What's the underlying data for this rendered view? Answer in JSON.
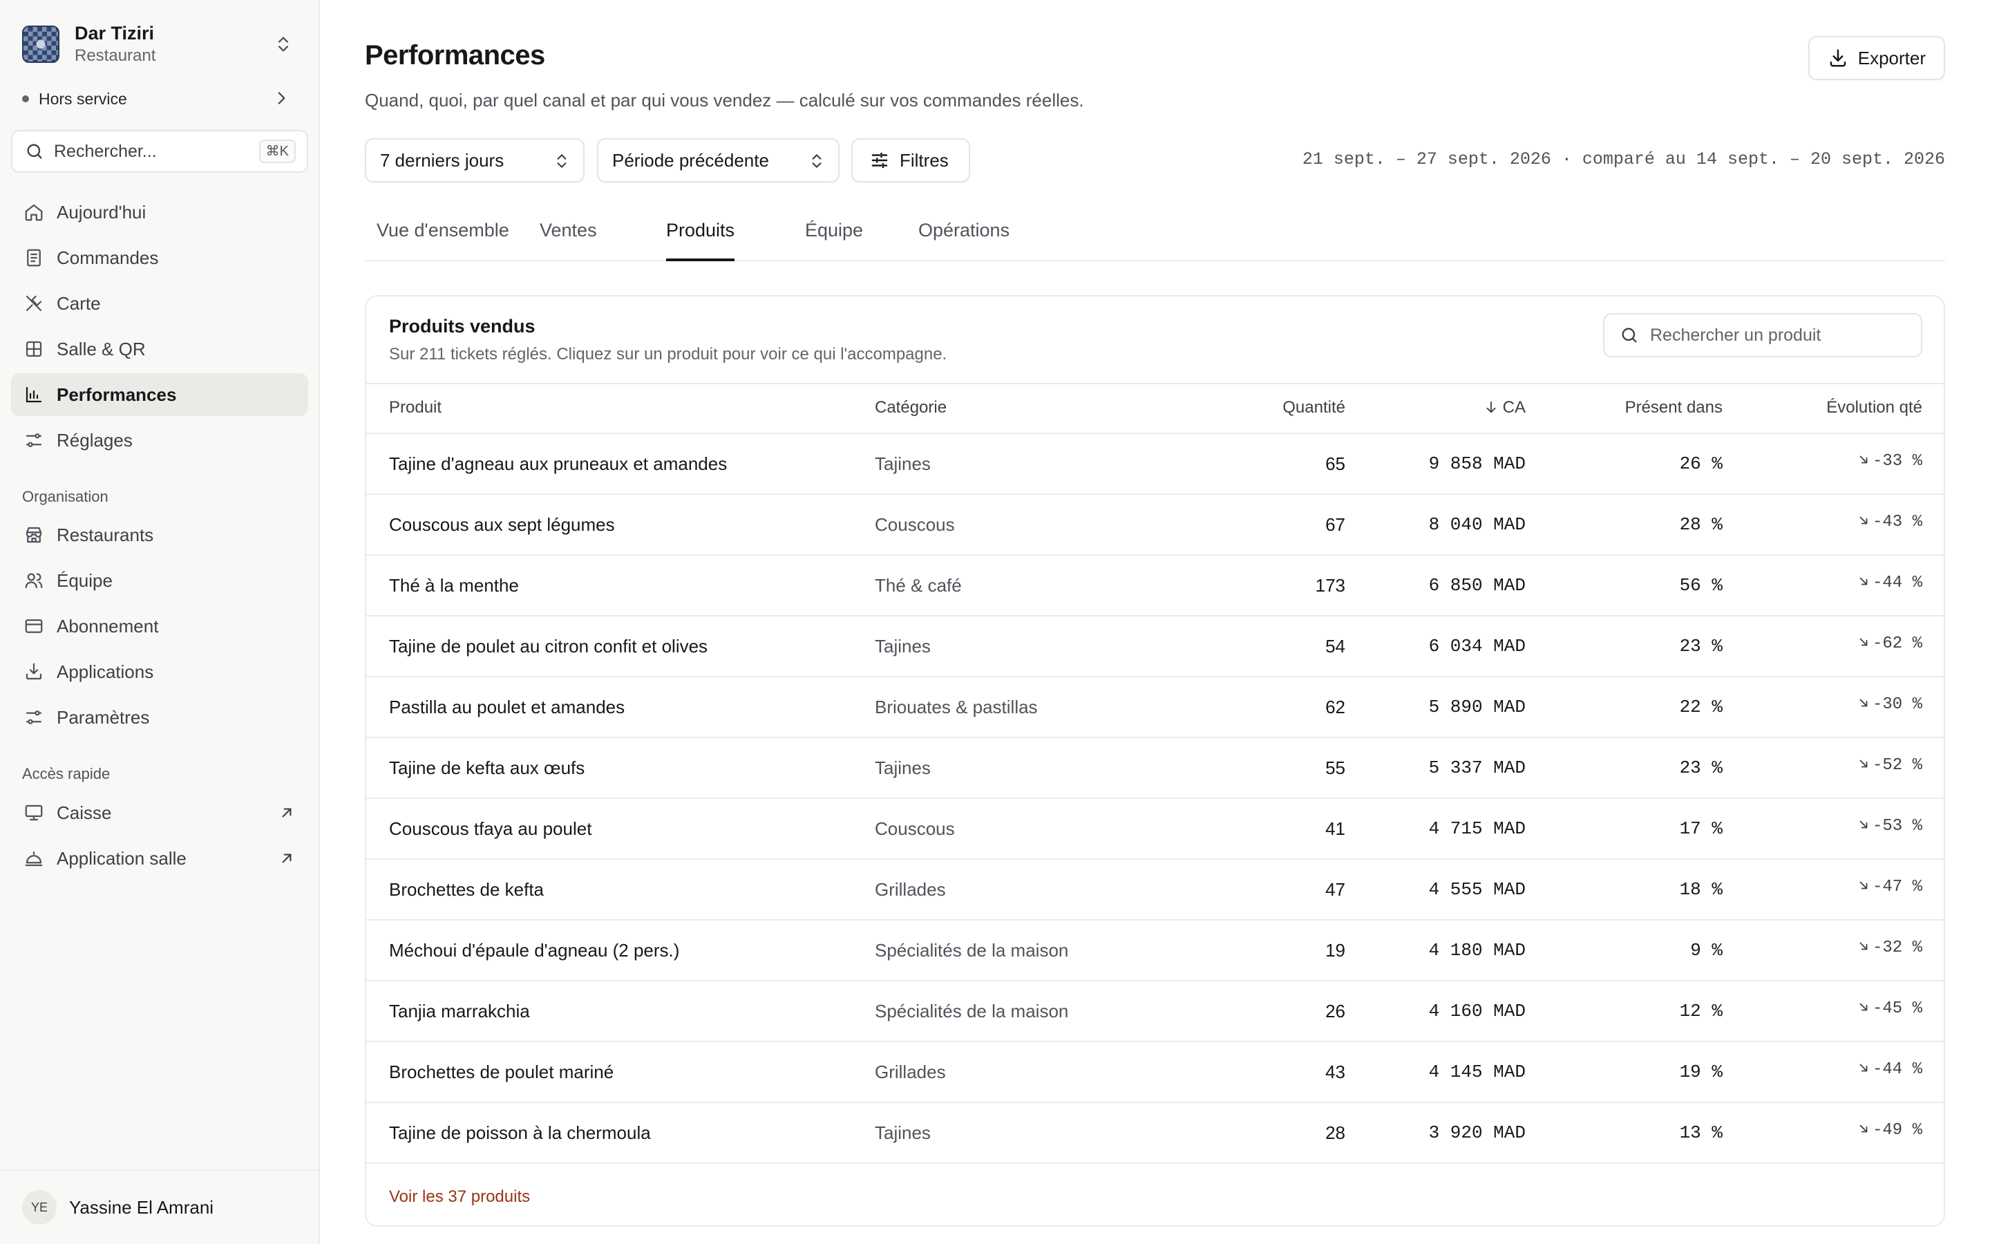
{
  "workspace": {
    "name": "Dar Tiziri",
    "type": "Restaurant"
  },
  "status": {
    "label": "Hors service"
  },
  "sidebar_search": {
    "placeholder": "Rechercher...",
    "shortcut": "⌘K"
  },
  "nav_main": [
    {
      "label": "Aujourd'hui",
      "icon": "home-icon"
    },
    {
      "label": "Commandes",
      "icon": "receipt-icon"
    },
    {
      "label": "Carte",
      "icon": "utensils-icon"
    },
    {
      "label": "Salle & QR",
      "icon": "grid-icon"
    },
    {
      "label": "Performances",
      "icon": "bar-chart-icon",
      "active": true
    },
    {
      "label": "Réglages",
      "icon": "sliders-icon"
    }
  ],
  "org_section": {
    "title": "Organisation",
    "items": [
      {
        "label": "Restaurants",
        "icon": "store-icon"
      },
      {
        "label": "Équipe",
        "icon": "users-icon"
      },
      {
        "label": "Abonnement",
        "icon": "credit-card-icon"
      },
      {
        "label": "Applications",
        "icon": "download-tray-icon"
      },
      {
        "label": "Paramètres",
        "icon": "settings-sliders-icon"
      }
    ]
  },
  "quick_section": {
    "title": "Accès rapide",
    "items": [
      {
        "label": "Caisse",
        "icon": "monitor-icon"
      },
      {
        "label": "Application salle",
        "icon": "cloche-icon"
      }
    ]
  },
  "user": {
    "initials": "YE",
    "name": "Yassine El Amrani"
  },
  "header": {
    "title": "Performances",
    "subtitle": "Quand, quoi, par quel canal et par qui vous vendez — calculé sur vos commandes réelles.",
    "export_label": "Exporter"
  },
  "filters": {
    "period": "7 derniers jours",
    "comparison": "Période précédente",
    "filters_label": "Filtres",
    "date_range": "21 sept. – 27 sept. 2026 · comparé au 14 sept. – 20 sept. 2026"
  },
  "tabs": [
    {
      "label": "Vue d'ensemble"
    },
    {
      "label": "Ventes"
    },
    {
      "label": "Produits",
      "active": true
    },
    {
      "label": "Équipe"
    },
    {
      "label": "Opérations"
    }
  ],
  "card": {
    "title": "Produits vendus",
    "subtitle": "Sur 211 tickets réglés. Cliquez sur un produit pour voir ce qui l'accompagne.",
    "search_placeholder": "Rechercher un produit",
    "columns": {
      "product": "Produit",
      "category": "Catégorie",
      "quantity": "Quantité",
      "revenue": "CA",
      "presence": "Présent dans",
      "evolution": "Évolution qté"
    },
    "rows": [
      {
        "product": "Tajine d'agneau aux pruneaux et amandes",
        "category": "Tajines",
        "quantity": "65",
        "revenue": "9 858 MAD",
        "presence": "26 %",
        "evolution": "-33 %"
      },
      {
        "product": "Couscous aux sept légumes",
        "category": "Couscous",
        "quantity": "67",
        "revenue": "8 040 MAD",
        "presence": "28 %",
        "evolution": "-43 %"
      },
      {
        "product": "Thé à la menthe",
        "category": "Thé & café",
        "quantity": "173",
        "revenue": "6 850 MAD",
        "presence": "56 %",
        "evolution": "-44 %"
      },
      {
        "product": "Tajine de poulet au citron confit et olives",
        "category": "Tajines",
        "quantity": "54",
        "revenue": "6 034 MAD",
        "presence": "23 %",
        "evolution": "-62 %"
      },
      {
        "product": "Pastilla au poulet et amandes",
        "category": "Briouates & pastillas",
        "quantity": "62",
        "revenue": "5 890 MAD",
        "presence": "22 %",
        "evolution": "-30 %"
      },
      {
        "product": "Tajine de kefta aux œufs",
        "category": "Tajines",
        "quantity": "55",
        "revenue": "5 337 MAD",
        "presence": "23 %",
        "evolution": "-52 %"
      },
      {
        "product": "Couscous tfaya au poulet",
        "category": "Couscous",
        "quantity": "41",
        "revenue": "4 715 MAD",
        "presence": "17 %",
        "evolution": "-53 %"
      },
      {
        "product": "Brochettes de kefta",
        "category": "Grillades",
        "quantity": "47",
        "revenue": "4 555 MAD",
        "presence": "18 %",
        "evolution": "-47 %"
      },
      {
        "product": "Méchoui d'épaule d'agneau (2 pers.)",
        "category": "Spécialités de la maison",
        "quantity": "19",
        "revenue": "4 180 MAD",
        "presence": "9 %",
        "evolution": "-32 %"
      },
      {
        "product": "Tanjia marrakchia",
        "category": "Spécialités de la maison",
        "quantity": "26",
        "revenue": "4 160 MAD",
        "presence": "12 %",
        "evolution": "-45 %"
      },
      {
        "product": "Brochettes de poulet mariné",
        "category": "Grillades",
        "quantity": "43",
        "revenue": "4 145 MAD",
        "presence": "19 %",
        "evolution": "-44 %"
      },
      {
        "product": "Tajine de poisson à la chermoula",
        "category": "Tajines",
        "quantity": "28",
        "revenue": "3 920 MAD",
        "presence": "13 %",
        "evolution": "-49 %"
      }
    ],
    "see_all": "Voir les 37 produits"
  },
  "colors": {
    "accent_link": "#9a3412",
    "active_nav_bg": "#ebeae7",
    "sidebar_bg": "#f8f8f7"
  }
}
